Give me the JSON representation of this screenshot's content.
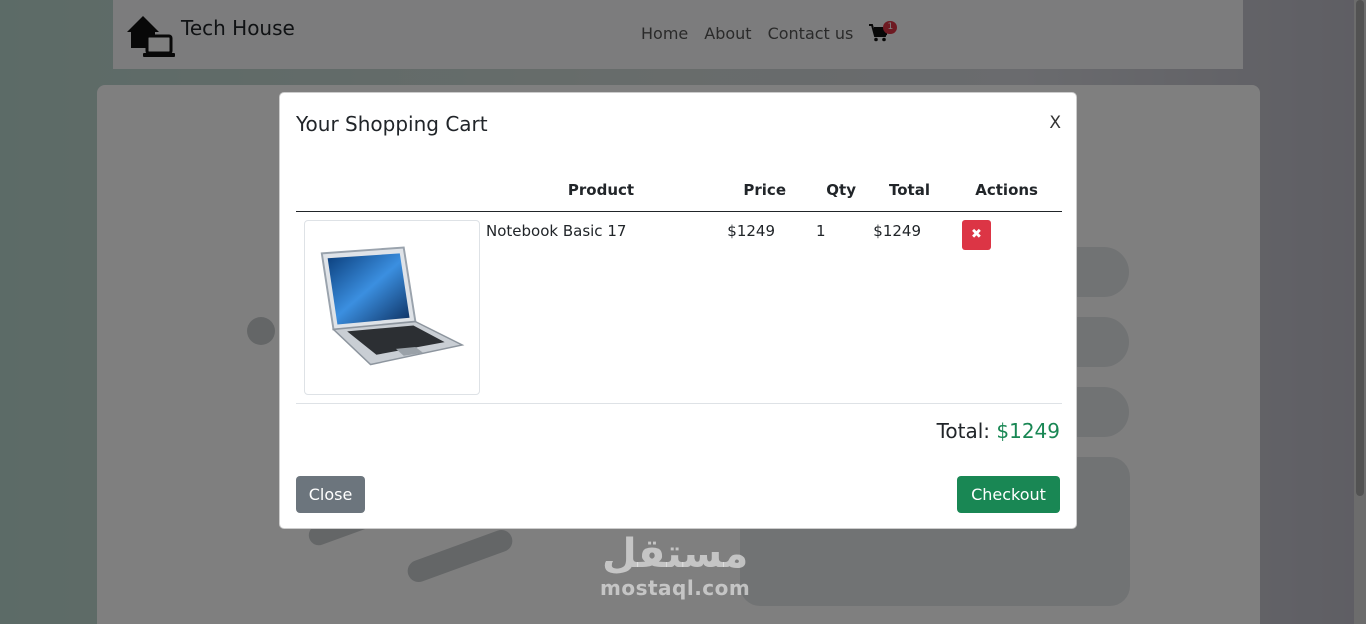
{
  "navbar": {
    "brand": "Tech House",
    "links": [
      "Home",
      "About",
      "Contact us"
    ],
    "cart_count": "1"
  },
  "modal": {
    "title": "Your Shopping Cart",
    "close_x": "X",
    "columns": [
      "Product",
      "Price",
      "Qty",
      "Total",
      "Actions"
    ],
    "item": {
      "name": "Notebook Basic 17",
      "price": "$1249",
      "qty": "1",
      "total": "$1249"
    },
    "total_label": "Total:",
    "total_value": "$1249",
    "close_button": "Close",
    "checkout_button": "Checkout"
  },
  "watermark": {
    "arabic": "مستقل",
    "latin": "mostaql.com"
  },
  "colors": {
    "danger": "#dc3545",
    "success": "#198754",
    "secondary": "#6c757d"
  }
}
